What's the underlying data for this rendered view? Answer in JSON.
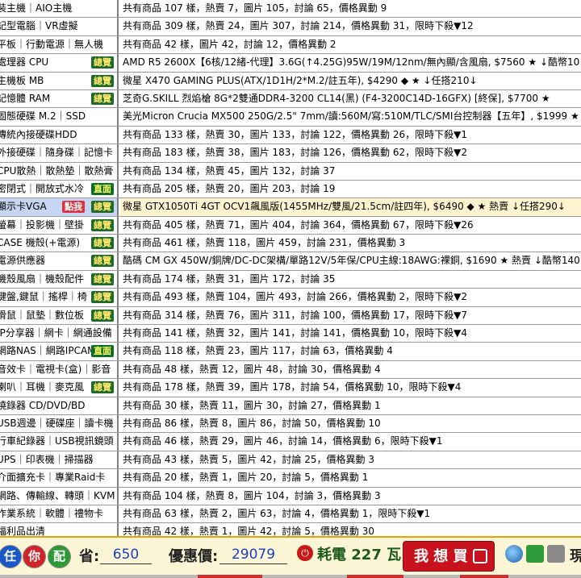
{
  "rows": [
    {
      "cat": "裝主機｜AIO主機",
      "tag": "",
      "info": "共有商品 107 樣，熱賣 7，圖片 105，討論 65，價格異動 9"
    },
    {
      "cat": "記型電腦｜VR虛擬",
      "tag": "",
      "info": "共有商品 309 樣，熱賣 24，圖片 307，討論 214，價格異動 31，限時下殺▼12"
    },
    {
      "cat": "平板｜行動電源｜無人機",
      "tag": "",
      "info": "共有商品 42 樣，圖片 42，討論 12，價格異動 2"
    },
    {
      "cat": "處理器 CPU",
      "tag": "總覽",
      "info": "AMD R5 2600X【6核/12緒-代理】3.6G(↑4.25G)95W/19M/12nm/無內顯/含風扇, $7560 ★ ↓酷幣10↓"
    },
    {
      "cat": "主機板 MB",
      "tag": "總覽",
      "info": "微星 X470 GAMING PLUS(ATX/1D1H/2*M.2/註五年), $4290 ◆ ★ ↓任搭210↓"
    },
    {
      "cat": "記憶體 RAM",
      "tag": "總覽",
      "info": "芝奇G.SKILL 烈焰槍 8G*2雙通DDR4-3200 CL14(黑) (F4-3200C14D-16GFX) [終保], $7700 ★"
    },
    {
      "cat": "固態硬碟 M.2｜SSD",
      "tag": "",
      "info": "美光Micron Crucia MX500 250G/2.5\" 7mm/讀:560M/寫:510M/TLC/SMI台控制器【五年】, $1999 ★"
    },
    {
      "cat": "傳統內接硬碟HDD",
      "tag": "",
      "info": "共有商品 133 樣，熱賣 30，圖片 133，討論 122，價格異動 26，限時下殺▼1"
    },
    {
      "cat": "外接硬碟｜隨身碟｜記憶卡",
      "tag": "",
      "info": "共有商品 183 樣，熱賣 38，圖片 183，討論 126，價格異動 62，限時下殺▼2"
    },
    {
      "cat": "CPU散熱｜散熱墊｜散熱膏",
      "tag": "",
      "info": "共有商品 134 樣，熱賣 45，圖片 132，討論 37"
    },
    {
      "cat": "密閉式｜開放式水冷",
      "tag": "直面",
      "info": "共有商品 205 樣，熱賣 20，圖片 203，討論 19"
    },
    {
      "cat": "顯示卡VGA",
      "tag": "總覽",
      "badge": "點我",
      "info": "微星 GTX1050Ti 4GT OCV1飆風版(1455MHz/雙風/21.5cm/註四年), $6490 ◆ ★ 熱賣 ↓任搭290↓",
      "highlight": true
    },
    {
      "cat": "螢幕｜投影機｜壁掛",
      "tag": "總覽",
      "info": "共有商品 405 樣，熱賣 71，圖片 404，討論 364，價格異動 67，限時下殺▼26"
    },
    {
      "cat": "CASE 機殼(+電源)",
      "tag": "總覽",
      "info": "共有商品 461 樣，熱賣 118，圖片 459，討論 231，價格異動 3"
    },
    {
      "cat": "電源供應器",
      "tag": "總覽",
      "info": "酷碼 CM GX 450W/銅牌/DC-DC架構/單路12V/5年保/CPU主線:18AWG:裸銅, $1690 ★ 熱賣 ↓酷幣140↓"
    },
    {
      "cat": "機殼風扇｜機殼配件",
      "tag": "總覽",
      "info": "共有商品 174 樣，熱賣 31，圖片 172，討論 35"
    },
    {
      "cat": "鍵盤,鍵鼠｜搖桿｜椅",
      "tag": "總覽",
      "info": "共有商品 493 樣，熱賣 104，圖片 493，討論 266，價格異動 2，限時下殺▼2"
    },
    {
      "cat": "滑鼠｜鼠墊｜數位板",
      "tag": "總覽",
      "info": "共有商品 314 樣，熱賣 76，圖片 311，討論 100，價格異動 17，限時下殺▼7"
    },
    {
      "cat": "IP分享器｜網卡｜網通設備",
      "tag": "",
      "info": "共有商品 141 樣，熱賣 32，圖片 141，討論 141，價格異動 10，限時下殺▼4"
    },
    {
      "cat": "網路NAS｜網路IPCAM",
      "tag": "直面",
      "info": "共有商品 118 樣，熱賣 23，圖片 117，討論 63，價格異動 4"
    },
    {
      "cat": "音效卡｜電視卡(盒)｜影音",
      "tag": "",
      "info": "共有商品 48 樣，熱賣 12，圖片 48，討論 30，價格異動 4"
    },
    {
      "cat": "喇叭｜耳機｜麥克風",
      "tag": "總覽",
      "info": "共有商品 178 樣，熱賣 39，圖片 178，討論 54，價格異動 10，限時下殺▼4"
    },
    {
      "cat": "燒錄器 CD/DVD/BD",
      "tag": "",
      "info": "共有商品 30 樣，熱賣 11，圖片 30，討論 27，價格異動 1"
    },
    {
      "cat": "USB週邊｜硬碟座｜讀卡機",
      "tag": "",
      "info": "共有商品 86 樣，熱賣 8，圖片 86，討論 50，價格異動 10"
    },
    {
      "cat": "行車紀錄器｜USB視訊鏡頭",
      "tag": "",
      "info": "共有商品 46 樣，熱賣 29，圖片 46，討論 14，價格異動 6，限時下殺▼1"
    },
    {
      "cat": "UPS｜印表機｜掃描器",
      "tag": "",
      "info": "共有商品 43 樣，熱賣 5，圖片 42，討論 25，價格異動 3"
    },
    {
      "cat": "介面擴充卡｜專業Raid卡",
      "tag": "",
      "info": "共有商品 20 樣，熱賣 1，圖片 20，討論 5，價格異動 1"
    },
    {
      "cat": "網路、傳輸線、轉頭｜KVM",
      "tag": "",
      "info": "共有商品 104 樣，熱賣 8，圖片 104，討論 3，價格異動 3"
    },
    {
      "cat": "作業系統｜軟體｜禮物卡",
      "tag": "",
      "info": "共有商品 63 樣，熱賣 2，圖片 63，討論 4，價格異動 1，限時下殺▼1"
    },
    {
      "cat": "福利品出清",
      "tag": "",
      "info": "共有商品 42 樣，熱賣 1，圖片 42，討論 5，價格異動 30"
    }
  ],
  "bottom": {
    "btn_1": "任",
    "btn_2": "你",
    "btn_3": "配",
    "save_label": "省:",
    "save_value": "650",
    "price_label": "優惠價:",
    "price_value": "29079",
    "power_text": "耗電 227 瓦",
    "buy_label": "我 想 買",
    "trailing": "現"
  },
  "colors": {
    "accent": "#c8131e",
    "tag_green": "#1c6b2a",
    "highlight": "#fff4cf"
  }
}
